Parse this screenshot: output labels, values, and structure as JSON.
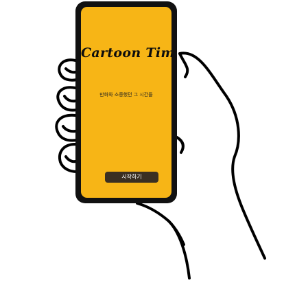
{
  "app": {
    "title": "Cartoon Time",
    "tagline": "만화와 소중했던 그 시간들",
    "start_button_label": "시작하기"
  },
  "colors": {
    "screen_background": "#f7b516",
    "phone_frame": "#111111",
    "button_background": "#3a2f22",
    "button_text": "#ffffff"
  },
  "icons": {
    "hand": "hand-holding-phone-illustration"
  }
}
